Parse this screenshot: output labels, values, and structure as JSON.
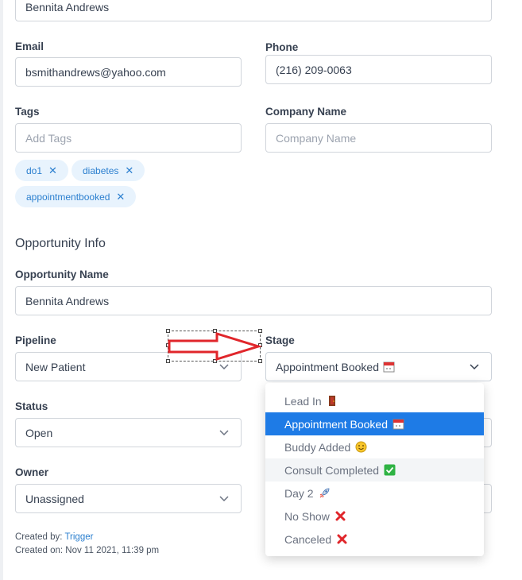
{
  "contact": {
    "name_value": "Bennita Andrews",
    "email_label": "Email",
    "email_value": "bsmithandrews@yahoo.com",
    "phone_label": "Phone",
    "phone_value": "(216) 209-0063",
    "tags_label": "Tags",
    "tags_placeholder": "Add Tags",
    "company_label": "Company Name",
    "company_placeholder": "Company Name",
    "tags": [
      "do1",
      "diabetes",
      "appointmentbooked"
    ]
  },
  "opportunity": {
    "section_title": "Opportunity Info",
    "name_label": "Opportunity Name",
    "name_value": "Bennita Andrews",
    "pipeline_label": "Pipeline",
    "pipeline_value": "New Patient",
    "stage_label": "Stage",
    "stage_value": "Appointment Booked",
    "status_label": "Status",
    "status_value": "Open",
    "owner_label": "Owner",
    "owner_value": "Unassigned"
  },
  "meta": {
    "created_by_label": "Created by:",
    "created_by_value": "Trigger",
    "created_on": "Created on: Nov 11 2021, 11:39 pm"
  },
  "stage_options": [
    {
      "label": "Lead In",
      "icon": "door-icon"
    },
    {
      "label": "Appointment Booked",
      "icon": "calendar-icon",
      "selected": true
    },
    {
      "label": "Buddy Added",
      "icon": "smiley-icon"
    },
    {
      "label": "Consult Completed",
      "icon": "check-mark-icon",
      "hover": true
    },
    {
      "label": "Day 2",
      "icon": "rocket-icon"
    },
    {
      "label": "No Show",
      "icon": "cross-mark-icon"
    },
    {
      "label": "Canceled",
      "icon": "cross-mark-icon"
    }
  ],
  "colors": {
    "accent": "#1e7be6",
    "tag_bg": "#e8f3fd",
    "tag_text": "#2b7fcf",
    "annotation_arrow": "#e0262b"
  }
}
